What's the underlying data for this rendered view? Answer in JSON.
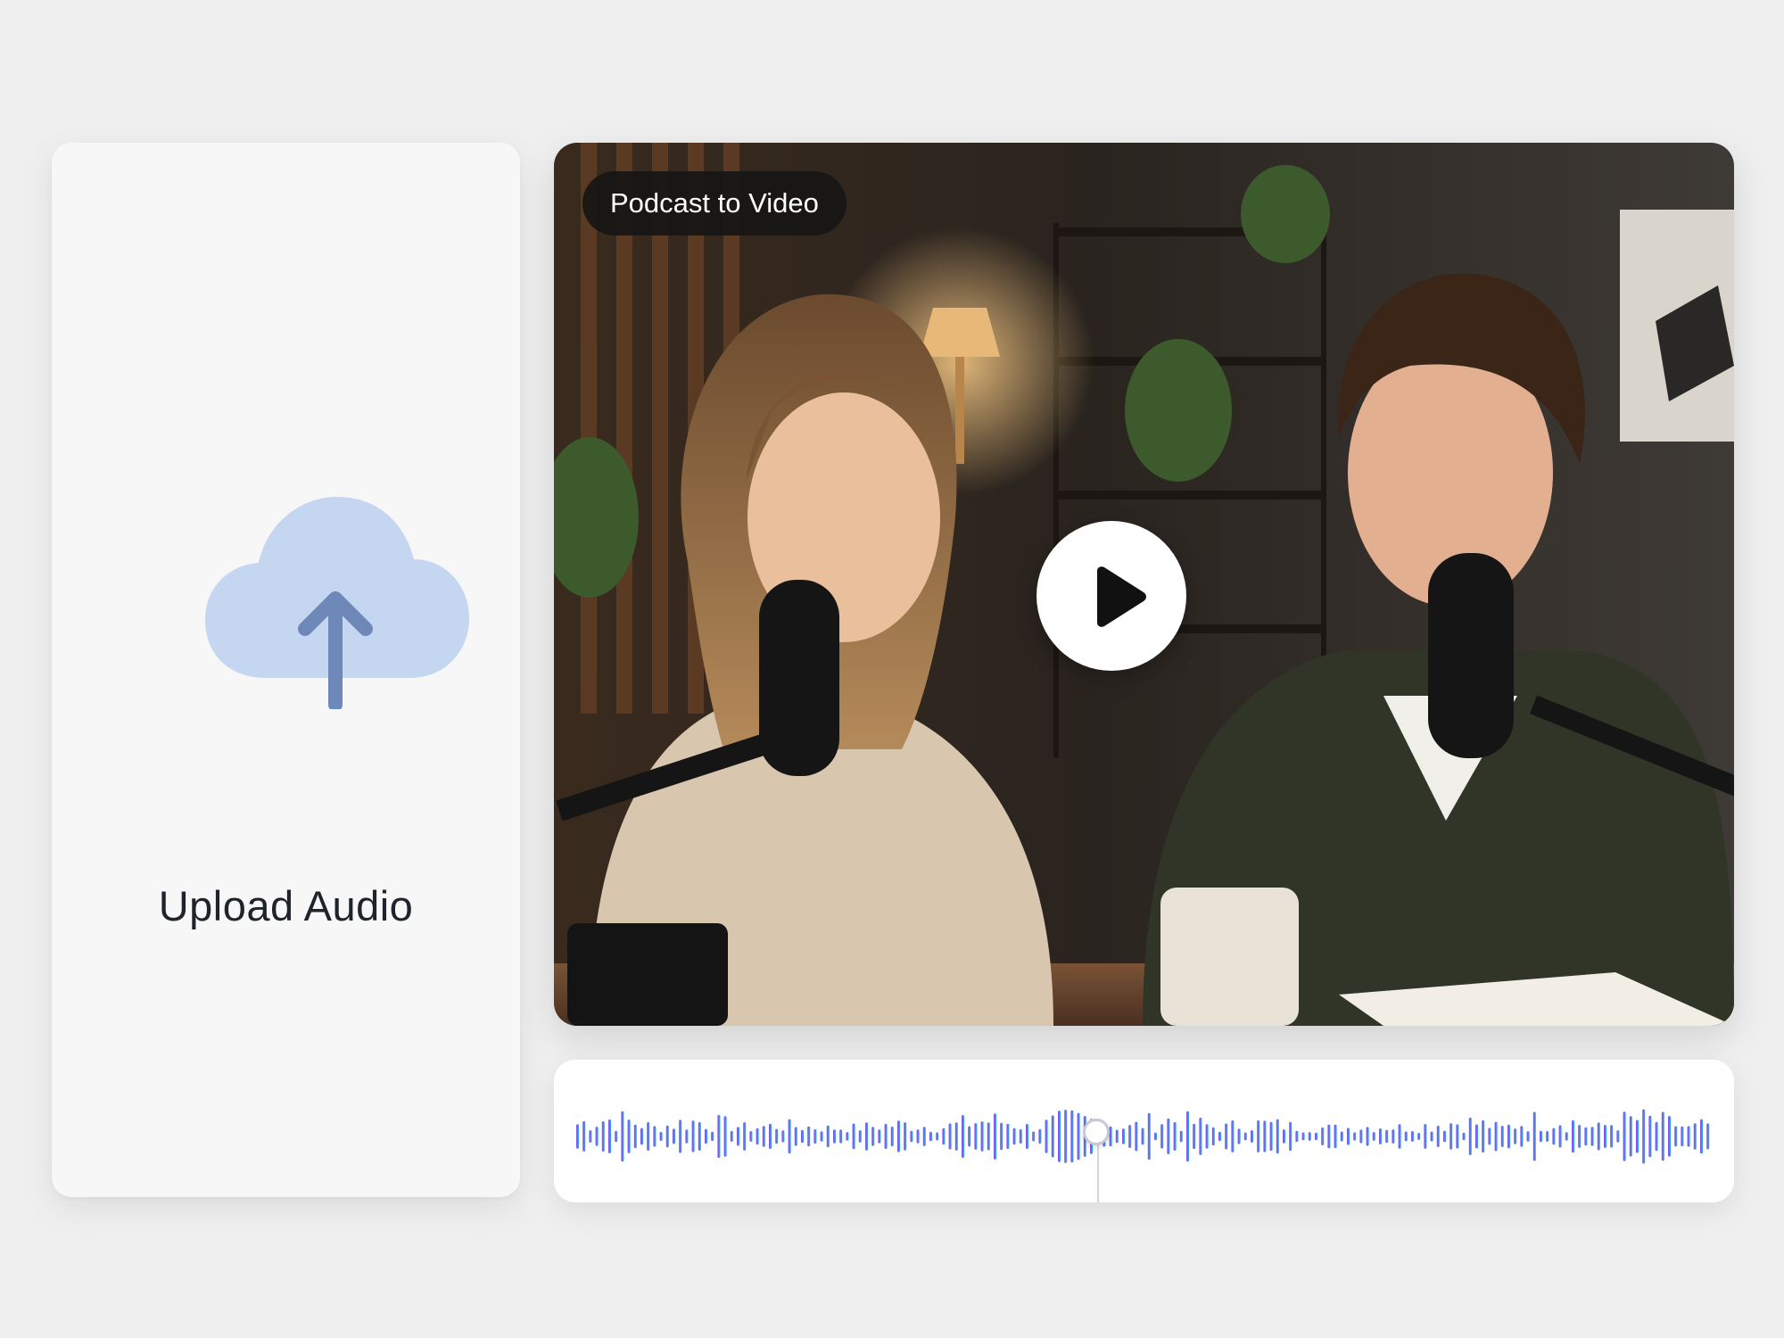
{
  "upload_panel": {
    "label": "Upload Audio",
    "icon": "cloud-upload-icon",
    "cloud_color": "#c5d6f0",
    "arrow_color": "#6d88b9"
  },
  "video_preview": {
    "badge_label": "Podcast to Video",
    "play_icon": "play-icon",
    "scene_description_icon": "podcast-video-thumbnail"
  },
  "waveform": {
    "gradient_start": "#9a3df0",
    "gradient_end": "#1fb6e6",
    "playhead_position": 0.45,
    "playhead_icon": "playhead-handle-icon"
  },
  "colors": {
    "background": "#efeff0",
    "card": "#f7f7f8",
    "badge_bg": "#161616",
    "text_dark": "#1f232a"
  }
}
